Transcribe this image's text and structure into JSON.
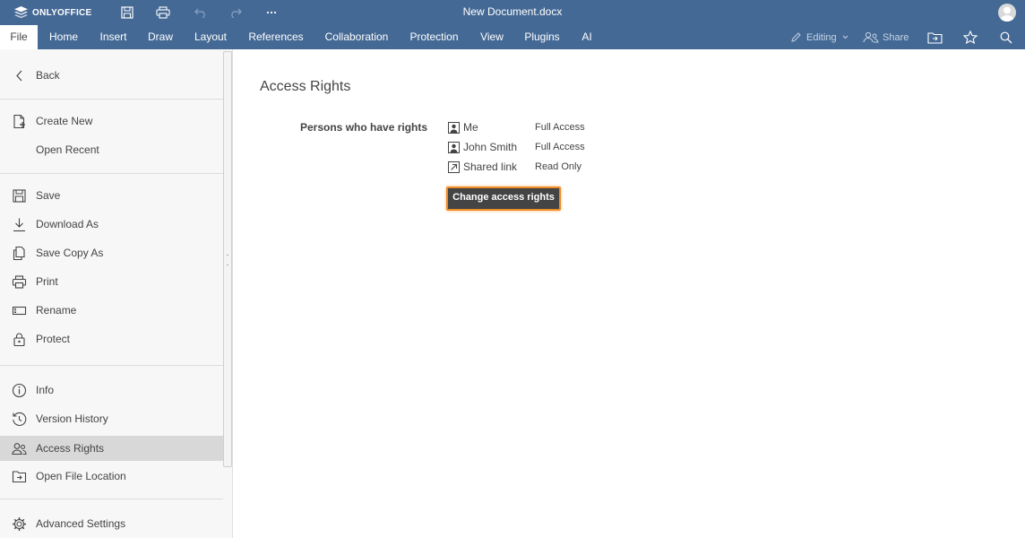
{
  "app": {
    "logo_text": "ONLYOFFICE",
    "document_title": "New Document.docx"
  },
  "tabs": [
    {
      "label": "File",
      "active": true
    },
    {
      "label": "Home"
    },
    {
      "label": "Insert"
    },
    {
      "label": "Draw"
    },
    {
      "label": "Layout"
    },
    {
      "label": "References"
    },
    {
      "label": "Collaboration"
    },
    {
      "label": "Protection"
    },
    {
      "label": "View"
    },
    {
      "label": "Plugins"
    },
    {
      "label": "AI"
    }
  ],
  "toolbar_right": {
    "editing_label": "Editing",
    "share_label": "Share"
  },
  "sidebar": {
    "back_label": "Back",
    "items": [
      {
        "label": "Create New",
        "icon": "create-new-icon"
      },
      {
        "label": "Open Recent",
        "icon": ""
      },
      {
        "label": "Save",
        "icon": "save-icon"
      },
      {
        "label": "Download As",
        "icon": "download-icon"
      },
      {
        "label": "Save Copy As",
        "icon": "save-copy-icon"
      },
      {
        "label": "Print",
        "icon": "print-icon"
      },
      {
        "label": "Rename",
        "icon": "rename-icon"
      },
      {
        "label": "Protect",
        "icon": "lock-icon"
      },
      {
        "label": "Info",
        "icon": "info-icon"
      },
      {
        "label": "Version History",
        "icon": "history-icon"
      },
      {
        "label": "Access Rights",
        "icon": "users-icon",
        "active": true
      },
      {
        "label": "Open File Location",
        "icon": "folder-open-icon"
      },
      {
        "label": "Advanced Settings",
        "icon": "gear-icon"
      }
    ]
  },
  "main": {
    "title": "Access Rights",
    "rights_label": "Persons who have rights",
    "persons": [
      {
        "name": "Me",
        "access": "Full Access",
        "icon": "user-icon"
      },
      {
        "name": "John Smith",
        "access": "Full Access",
        "icon": "user-icon"
      },
      {
        "name": "Shared link",
        "access": "Read Only",
        "icon": "external-link-icon"
      }
    ],
    "change_button": "Change access rights"
  },
  "colors": {
    "header_bg": "#446995",
    "active_item_bg": "#d8d8d8",
    "button_bg": "#444444",
    "button_focus_border": "#f08a24"
  }
}
